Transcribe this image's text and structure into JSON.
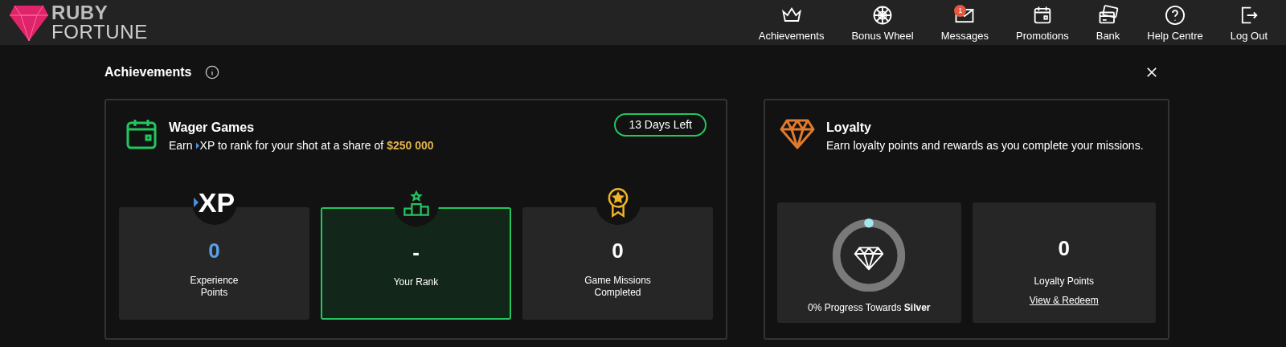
{
  "logo": {
    "line_1": "RUBY",
    "line_2": "FORTUNE"
  },
  "nav": [
    {
      "label": "Achievements"
    },
    {
      "label": "Bonus Wheel"
    },
    {
      "label": "Messages",
      "badge": "1"
    },
    {
      "label": "Promotions"
    },
    {
      "label": "Bank"
    },
    {
      "label": "Help Centre"
    },
    {
      "label": "Log Out"
    }
  ],
  "panel": {
    "title": "Achievements"
  },
  "wager": {
    "title": "Wager Games",
    "subtitle_start": "Earn",
    "subtitle_end": "XP to rank for your shot at a share of",
    "prize": "$250 000",
    "days_left": "13 Days Left",
    "stats": [
      {
        "kind": "xp",
        "icon_text": "XP",
        "value": "0",
        "label": "Experience Points",
        "selected": false
      },
      {
        "kind": "rank",
        "value": "-",
        "label": "Your Rank",
        "selected": true
      },
      {
        "kind": "missions",
        "value": "0",
        "label": "Game Missions Completed",
        "selected": false
      }
    ]
  },
  "loyalty": {
    "title": "Loyalty",
    "subtitle": "Earn loyalty points and rewards as you complete your missions.",
    "progress": {
      "text": "0% Progress Towards **Silver**"
    },
    "points": {
      "value": "0",
      "label": "Loyalty Points",
      "link": "View & Redeem"
    }
  }
}
